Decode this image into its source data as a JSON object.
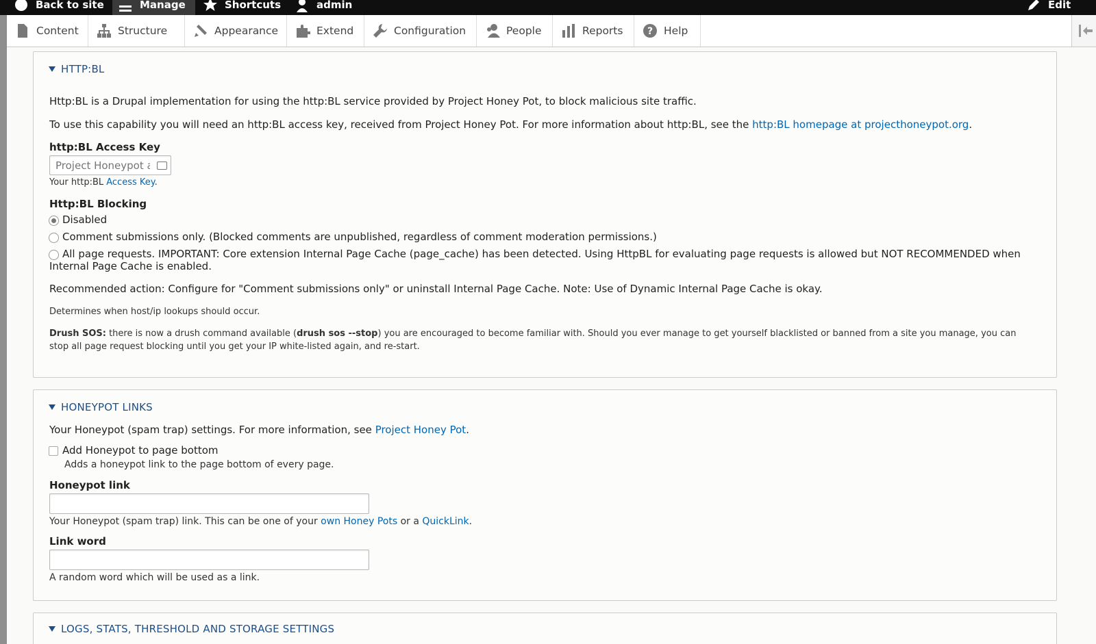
{
  "toolbar": {
    "back_to_site": "Back to site",
    "manage": "Manage",
    "shortcuts": "Shortcuts",
    "user": "admin",
    "edit": "Edit"
  },
  "tray": {
    "items": [
      {
        "label": "Content",
        "icon": "file-icon"
      },
      {
        "label": "Structure",
        "icon": "sitemap-icon"
      },
      {
        "label": "Appearance",
        "icon": "paintbrush-icon"
      },
      {
        "label": "Extend",
        "icon": "puzzle-icon"
      },
      {
        "label": "Configuration",
        "icon": "wrench-icon"
      },
      {
        "label": "People",
        "icon": "people-icon"
      },
      {
        "label": "Reports",
        "icon": "bar-chart-icon"
      },
      {
        "label": "Help",
        "icon": "help-icon"
      }
    ]
  },
  "httpbl": {
    "legend": "HTTP:BL",
    "intro": "Http:BL is a Drupal implementation for using the http:BL service provided by Project Honey Pot, to block malicious site traffic.",
    "usage_prefix": "To use this capability you will need an http:BL access key, received from Project Honey Pot. For more information about http:BL, see the ",
    "usage_link": "http:BL homepage at projecthoneypot.org",
    "usage_suffix": ".",
    "access_key_label": "http:BL Access Key",
    "access_key_placeholder": "Project Honeypot access key",
    "access_key_desc_prefix": "Your http:BL ",
    "access_key_desc_link": "Access Key",
    "access_key_desc_suffix": ".",
    "blocking_label": "Http:BL Blocking",
    "options": {
      "disabled": "Disabled",
      "comments": "Comment submissions only. (Blocked comments are unpublished, regardless of comment moderation permissions.)",
      "all_pages": "All page requests. IMPORTANT: Core extension Internal Page Cache (page_cache) has been detected. Using HttpBL for evaluating page requests is allowed but NOT RECOMMENDED when Internal Page Cache is enabled."
    },
    "recommended": "Recommended action: Configure for \"Comment submissions only\" or uninstall Internal Page Cache. Note: Use of Dynamic Internal Page Cache is okay.",
    "determines": "Determines when host/ip lookups should occur.",
    "sos_label": "Drush SOS:",
    "sos_text1": " there is now a drush command available (",
    "sos_cmd": "drush sos --stop",
    "sos_text2": ") you are encouraged to become familiar with. Should you ever manage to get yourself blacklisted or banned from a site you manage, you can stop all page request blocking until you get your IP white-listed again, and re-start."
  },
  "honeypot": {
    "legend": "HONEYPOT LINKS",
    "intro_prefix": "Your Honeypot (spam trap) settings. For more information, see ",
    "intro_link": "Project Honey Pot",
    "intro_suffix": ".",
    "add_label": "Add Honeypot to page bottom",
    "add_desc": "Adds a honeypot link to the page bottom of every page.",
    "link_label": "Honeypot link",
    "link_value": "",
    "link_desc_prefix": "Your Honeypot (spam trap) link. This can be one of your ",
    "link_desc_link1": "own Honey Pots",
    "link_desc_mid": " or a ",
    "link_desc_link2": "QuickLink",
    "link_desc_suffix": ".",
    "word_label": "Link word",
    "word_value": "",
    "word_desc": "A random word which will be used as a link."
  },
  "logs": {
    "legend": "LOGS, STATS, THRESHOLD AND STORAGE SETTINGS"
  },
  "colors": {
    "link": "#0066b3",
    "legend": "#1d4e87",
    "toolbar": "#0f0f0f"
  }
}
